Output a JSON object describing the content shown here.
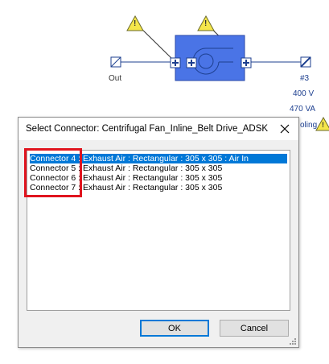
{
  "diagram": {
    "left_label": "Out",
    "right_tag": "#3",
    "voltage": "400 V",
    "power": "470 VA",
    "cut_label": "oling",
    "warning_glyph": "!"
  },
  "dialog": {
    "title": "Select Connector: Centrifugal Fan_Inline_Belt Drive_ADSK",
    "close_icon": "close-icon",
    "items": [
      "Connector 4 : Exhaust Air : Rectangular : 305 x 305 : Air In",
      "Connector 5 : Exhaust Air : Rectangular : 305 x 305",
      "Connector 6 : Exhaust Air : Rectangular : 305 x 305",
      "Connector 7 : Exhaust Air : Rectangular : 305 x 305"
    ],
    "selected_index": 0,
    "ok_label": "OK",
    "cancel_label": "Cancel"
  },
  "colors": {
    "fan_body": "#4a74e6",
    "cad_line": "#1d3f8f",
    "warning_fill": "#f5e64a",
    "highlight": "#e0141e",
    "selection": "#0078d7"
  }
}
